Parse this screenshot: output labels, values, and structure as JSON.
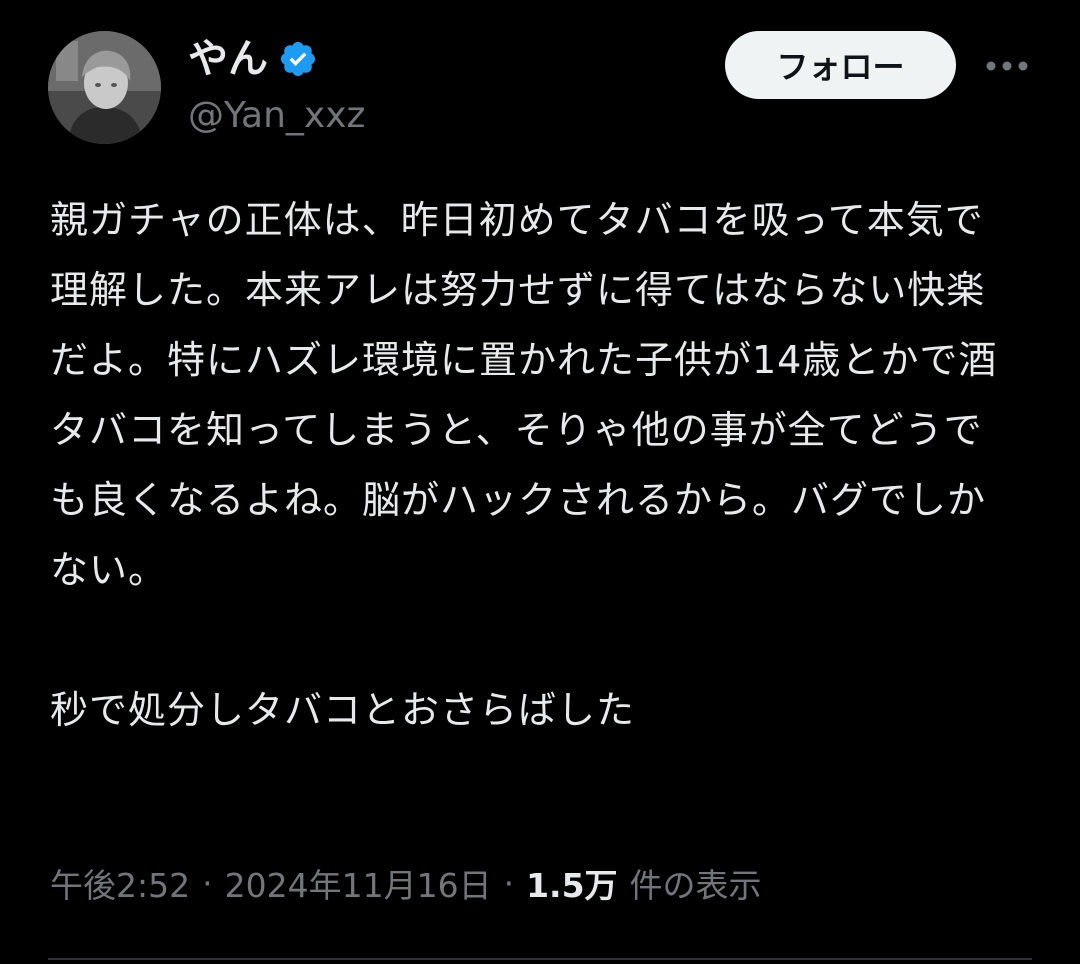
{
  "author": {
    "display_name": "やん",
    "handle": "@Yan_xxz",
    "verified": true,
    "avatar_icon": "profile-photo-grayscale",
    "verified_icon": "verified-badge-icon",
    "verified_color": "#1d9bf0"
  },
  "actions": {
    "follow_label": "フォロー",
    "more_icon": "more-options-icon"
  },
  "tweet": {
    "paragraphs": [
      "親ガチャの正体は、昨日初めてタバコを吸って本気で理解した。本来アレは努力せずに得てはならない快楽だよ。特にハズレ環境に置かれた子供が14歳とかで酒タバコを知ってしまうと、そりゃ他の事が全てどうでも良くなるよね。脳がハックされるから。バグでしかない。",
      "秒で処分しタバコとおさらばした"
    ]
  },
  "meta": {
    "time": "午後2:52",
    "separator": "·",
    "date": "2024年11月16日",
    "views_count": "1.5万",
    "views_label": "件の表示"
  },
  "colors": {
    "background": "#000000",
    "text_primary": "#e7e9ea",
    "text_secondary": "#71767b",
    "button_bg": "#eff3f4",
    "divider": "#2f3336"
  }
}
